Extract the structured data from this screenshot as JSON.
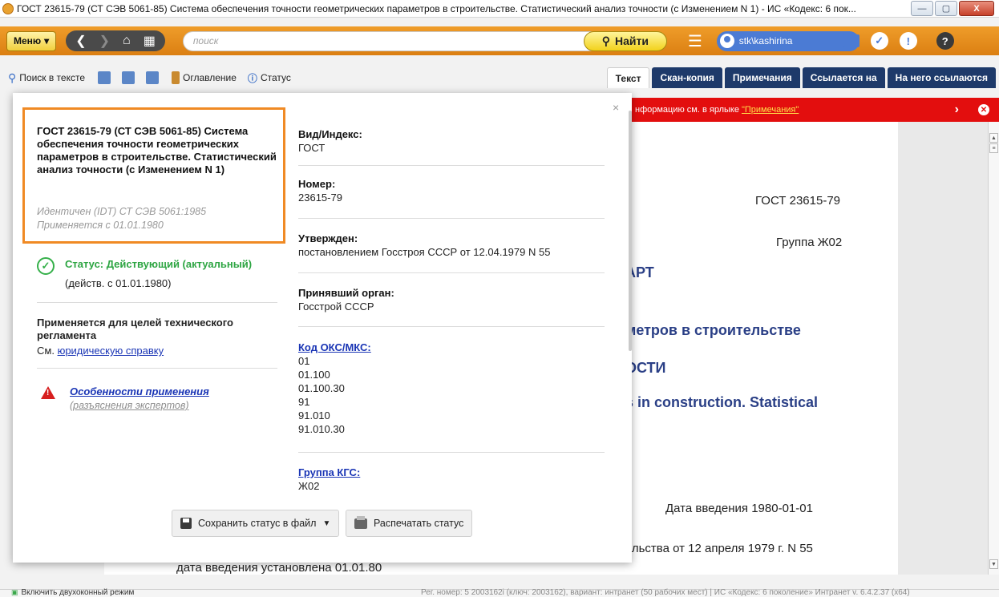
{
  "window": {
    "title": "ГОСТ 23615-79 (СТ СЭВ 5061-85) Система обеспечения точности геометрических параметров в строительстве. Статистический анализ точности (с Изменением N 1) - ИС «Кодекс: 6 пок...",
    "minimize": "—",
    "maximize": "▢",
    "close": "X"
  },
  "topbar": {
    "menu_label": "Меню",
    "search_placeholder": "поиск",
    "find_label": "Найти",
    "user": "stk\\kashirina",
    "help": "?"
  },
  "toolbar": {
    "search_in_text": "Поиск в тексте",
    "contents": "Оглавление",
    "status": "Статус",
    "tabs": [
      "Текст",
      "Скан-копия",
      "Примечания",
      "Ссылается на",
      "На него ссылаются"
    ]
  },
  "notice": {
    "text": "нформацию см. в ярлыке",
    "link": "\"Примечания\"",
    "next": "›",
    "close": "✕"
  },
  "document": {
    "code": "ГОСТ 23615-79",
    "group": "Группа Ж02",
    "heading1": "АРТ",
    "heading2": "метров в строительстве",
    "heading3": "ОСТИ",
    "heading4": "s in construction. Statistical",
    "date_intro": "Дата введения 1980-01-01",
    "resolution": "ельства от 12 апреля 1979 г. N 55",
    "date_set": "дата введения установлена 01.01.80"
  },
  "popup": {
    "close": "×",
    "title": "ГОСТ 23615-79 (СТ СЭВ 5061-85) Система обеспечения точности геометрических параметров в строительстве. Статистический анализ точности (с Изменением N 1)",
    "identical": "Идентичен (IDT) СТ СЭВ 5061:1985",
    "applied_since": "Применяется с 01.01.1980",
    "status": "Статус: Действующий (актуальный)",
    "status_since": "(действ. с 01.01.1980)",
    "reg_purpose": "Применяется для целей технического регламента",
    "see_prefix": "См.",
    "legal_ref": "юридическую справку",
    "features": "Особенности применения",
    "features_sub": "(разъяснения экспертов)",
    "fields": {
      "kind_label": "Вид/Индекс:",
      "kind_value": "ГОСТ",
      "number_label": "Номер:",
      "number_value": "23615-79",
      "approved_label": "Утвержден:",
      "approved_value": "постановлением Госстроя СССР от 12.04.1979 N 55",
      "body_label": "Принявший орган:",
      "body_value": "Госстрой СССР",
      "oks_label": "Код ОКС/МКС:",
      "oks_values": [
        "01",
        "01.100",
        "01.100.30",
        "91",
        "91.010",
        "91.010.30"
      ],
      "kgs_label": "Группа КГС:",
      "kgs_value": "Ж02"
    },
    "save_btn": "Сохранить статус в файл",
    "print_btn": "Распечатать статус"
  },
  "statusbar": {
    "dual_mode": "Включить двухоконный режим",
    "info": "Рег. номер: 5  2003162i (ключ: 2003162), вариант: интранет (50 рабочих мест)   |   ИС «Кодекс: 6 поколение» Интранет v. 6.4.2.37 (x64)"
  },
  "colors": {
    "accent_orange": "#e0891a",
    "tab_navy": "#1e3a6a",
    "status_green": "#2da542",
    "alert_red": "#e30e0e",
    "link_blue": "#1a35b5"
  }
}
